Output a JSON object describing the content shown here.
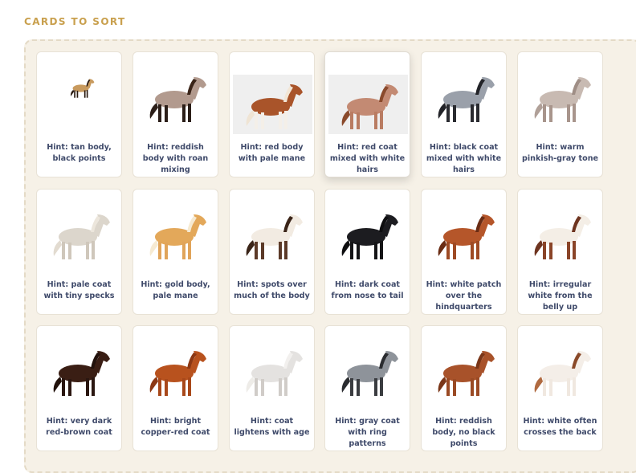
{
  "section": {
    "title": "CARDS TO SORT"
  },
  "cards": [
    {
      "hint": "Hint: tan body, black points",
      "icon": "horse-buckskin-icon",
      "body": "#c89a5e",
      "mane": "#2a1a10",
      "legs": "#2a1a10",
      "tail": "#2a1a10"
    },
    {
      "hint": "Hint: reddish body with roan mixing",
      "icon": "horse-red-roan-icon",
      "body": "#b29a8e",
      "mane": "#3a2418",
      "legs": "#2b1e18",
      "tail": "#2b1e18"
    },
    {
      "hint": "Hint: red body with pale mane",
      "icon": "horse-chestnut-flaxen-icon",
      "body": "#a9542a",
      "mane": "#f2e6d6",
      "legs": "#f4efe8",
      "tail": "#efe4d4"
    },
    {
      "hint": "Hint: red coat mixed with white hairs",
      "icon": "horse-strawberry-roan-icon",
      "body": "#c38a73",
      "mane": "#8a4a2c",
      "legs": "#b97c62",
      "tail": "#8a4a2c"
    },
    {
      "hint": "Hint: black coat mixed with white hairs",
      "icon": "horse-blue-roan-icon",
      "body": "#9aa0aa",
      "mane": "#222328",
      "legs": "#2a2b30",
      "tail": "#222328"
    },
    {
      "hint": "Hint: warm pinkish-gray tone",
      "icon": "horse-rose-gray-icon",
      "body": "#c8bab2",
      "mane": "#9f8e86",
      "legs": "#a8958c",
      "tail": "#b0a098"
    },
    {
      "hint": "Hint: pale coat with tiny specks",
      "icon": "horse-flea-bitten-gray-icon",
      "body": "#dcd6cc",
      "mane": "#ece6dc",
      "legs": "#cfc7bb",
      "tail": "#e2dbd0"
    },
    {
      "hint": "Hint: gold body, pale mane",
      "icon": "horse-palomino-icon",
      "body": "#e3a85a",
      "mane": "#f6ead2",
      "legs": "#e0a45a",
      "tail": "#f6ead2"
    },
    {
      "hint": "Hint: spots over much of the body",
      "icon": "horse-appaloosa-icon",
      "body": "#f2ebe2",
      "mane": "#3a2418",
      "legs": "#5c3a28",
      "tail": "#3a2418"
    },
    {
      "hint": "Hint: dark coat from nose to tail",
      "icon": "horse-black-icon",
      "body": "#1c1c20",
      "mane": "#0e0e10",
      "legs": "#141416",
      "tail": "#0e0e10"
    },
    {
      "hint": "Hint: white patch over the hindquarters",
      "icon": "horse-blanket-appaloosa-icon",
      "body": "#b5562a",
      "mane": "#6a2c14",
      "legs": "#9e4a24",
      "tail": "#6a2c14"
    },
    {
      "hint": "Hint: irregular white from the belly up",
      "icon": "horse-overo-icon",
      "body": "#f4eee6",
      "mane": "#6e3420",
      "legs": "#8a4428",
      "tail": "#6e3420"
    },
    {
      "hint": "Hint: very dark red-brown coat",
      "icon": "horse-liver-chestnut-icon",
      "body": "#3a1e14",
      "mane": "#22120c",
      "legs": "#2a1610",
      "tail": "#22120c"
    },
    {
      "hint": "Hint: bright copper-red coat",
      "icon": "horse-sorrel-icon",
      "body": "#b8521e",
      "mane": "#8c3814",
      "legs": "#a8481a",
      "tail": "#8c3814"
    },
    {
      "hint": "Hint: coat lightens with age",
      "icon": "horse-gray-icon",
      "body": "#e4e2e0",
      "mane": "#f2f0ee",
      "legs": "#d0ccc8",
      "tail": "#eeece8"
    },
    {
      "hint": "Hint: gray coat with ring patterns",
      "icon": "horse-dapple-gray-icon",
      "body": "#8e939a",
      "mane": "#2a2c30",
      "legs": "#3a3c40",
      "tail": "#2a2c30"
    },
    {
      "hint": "Hint: reddish body, no black points",
      "icon": "horse-chestnut-icon",
      "body": "#a8522a",
      "mane": "#7a3618",
      "legs": "#9a4a24",
      "tail": "#7a3618"
    },
    {
      "hint": "Hint: white often crosses the back",
      "icon": "horse-tobiano-icon",
      "body": "#f4eee8",
      "mane": "#8a4a2a",
      "legs": "#f0e8e0",
      "tail": "#b06a40"
    }
  ]
}
